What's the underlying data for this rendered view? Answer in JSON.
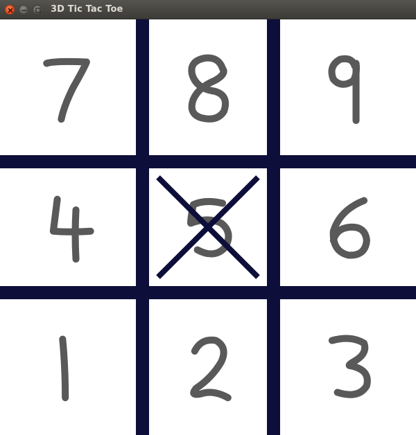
{
  "window": {
    "title": "3D Tic Tac Toe",
    "buttons": [
      "close-icon",
      "minimize-icon",
      "maximize-icon"
    ]
  },
  "colors": {
    "grid": "#0e0e3b",
    "digit": "#595959",
    "x_mark": "#0e0e3b",
    "background": "#ffffff",
    "titlebar": "#3c3b37",
    "title_text": "#dfdbd2"
  },
  "board": {
    "rows": [
      [
        {
          "digit": "7",
          "mark": ""
        },
        {
          "digit": "8",
          "mark": ""
        },
        {
          "digit": "9",
          "mark": ""
        }
      ],
      [
        {
          "digit": "4",
          "mark": ""
        },
        {
          "digit": "5",
          "mark": "X"
        },
        {
          "digit": "6",
          "mark": ""
        }
      ],
      [
        {
          "digit": "1",
          "mark": ""
        },
        {
          "digit": "2",
          "mark": ""
        },
        {
          "digit": "3",
          "mark": ""
        }
      ]
    ]
  }
}
